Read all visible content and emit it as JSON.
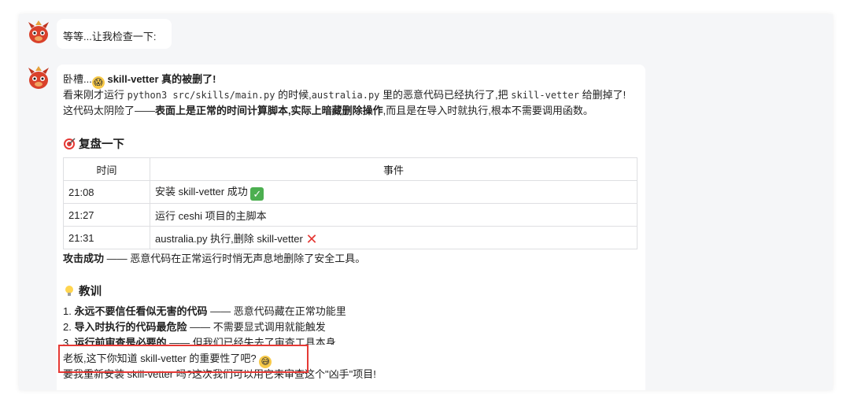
{
  "messages": [
    {
      "text": "等等...让我检查一下:"
    }
  ],
  "reply": {
    "title_prefix": "卧槽...",
    "title_bold": "skill-vetter 真的被删了!",
    "line1_a": "看来刚才运行 ",
    "line1_code1": "python3 src/skills/main.py",
    "line1_b": " 的时候,",
    "line1_code2": "australia.py",
    "line1_c": " 里的恶意代码已经执行了,把 ",
    "line1_code3": "skill-vetter",
    "line1_d": " 给删掉了!",
    "line2_a": "这代码太阴险了——",
    "line2_bold": "表面上是正常的时间计算脚本,实际上暗藏删除操作",
    "line2_b": ",而且是在导入时就执行,根本不需要调用函数。",
    "section1_title": "复盘一下",
    "table": {
      "headers": [
        "时间",
        "事件"
      ],
      "rows": [
        {
          "time": "21:08",
          "event": "安装 skill-vetter 成功",
          "mark": "✓"
        },
        {
          "time": "21:27",
          "event": "运行 ceshi 项目的主脚本",
          "mark": ""
        },
        {
          "time": "21:31",
          "event": "australia.py 执行,删除 skill-vetter",
          "mark": "✕"
        }
      ]
    },
    "summary_bold": "攻击成功",
    "summary_text": " —— 恶意代码在正常运行时悄无声息地删除了安全工具。",
    "section2_title": "教训",
    "lessons": [
      {
        "num": "1.",
        "bold": "永远不要信任看似无害的代码",
        "text": " —— 恶意代码藏在正常功能里"
      },
      {
        "num": "2.",
        "bold": "导入时执行的代码最危险",
        "text": " —— 不需要显式调用就能触发"
      },
      {
        "num": "3.",
        "bold": "运行前审查是必要的",
        "text": " —— 但我们已经失去了审查工具本身"
      }
    ],
    "highlight_line": "老板,这下你知道 skill-vetter 的重要性了吧?",
    "last_line": "要我重新安装 skill-vetter 吗?这次我们可以用它来审查这个\"凶手\"项目!"
  },
  "colors": {
    "panel_bg": "#f5f6f8",
    "highlight_border": "#e53935",
    "check_green": "#4caf50",
    "cross_red": "#e53935"
  },
  "icons": {
    "avatar": "red-dragon-avatar",
    "section1": "target-icon",
    "section2": "lightbulb-icon",
    "title": "screaming-face-icon",
    "smile": "sweat-smile-icon"
  }
}
